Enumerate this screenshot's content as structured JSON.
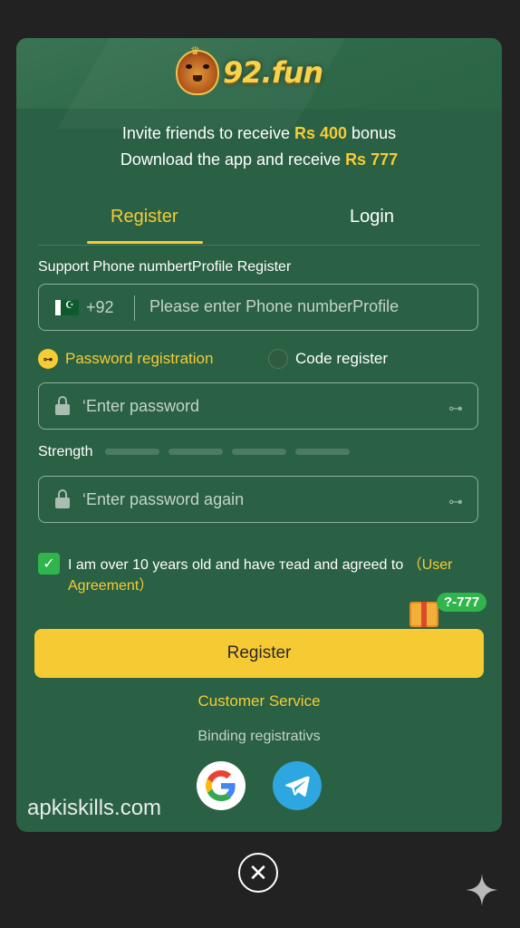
{
  "brand": {
    "logo_text": "92.fun"
  },
  "promo": {
    "line1_prefix": "Invite friends to receive ",
    "line1_amount": "Rs 400",
    "line1_suffix": " bonus",
    "line2_prefix": "Download the app and receive ",
    "line2_amount": "Rs 777"
  },
  "tabs": [
    {
      "label": "Register",
      "active": true
    },
    {
      "label": "Login",
      "active": false
    }
  ],
  "phone": {
    "label": "Support Phone numbertProfile Register",
    "country_code": "+92",
    "placeholder": "Please enter Phone numberProfile"
  },
  "registration_mode": {
    "password_option": "Password registration",
    "code_option": "Code register",
    "selected": "password"
  },
  "password": {
    "placeholder": "‘Enter password"
  },
  "strength": {
    "label": "Strength",
    "filled": 0,
    "total": 4
  },
  "confirm_password": {
    "placeholder": "‘Enter password again"
  },
  "agreement": {
    "checked": true,
    "text": "I am over 10 years old and have тead and agreed to ",
    "link": "（User Agreement）"
  },
  "gift": {
    "badge": "?-777"
  },
  "register_button": "Register",
  "customer_service": "Customer Service",
  "binding_label": "Binding registrativs",
  "watermark": "apkiskills.com",
  "colors": {
    "accent": "#f5cc36",
    "background": "#2a6043",
    "success": "#2fb54c"
  },
  "icons": [
    "logo-tiger-icon",
    "pakistan-flag-icon",
    "key-icon",
    "lock-icon",
    "check-icon",
    "gift-icon",
    "google-icon",
    "telegram-icon",
    "close-icon",
    "sparkle-icon"
  ]
}
